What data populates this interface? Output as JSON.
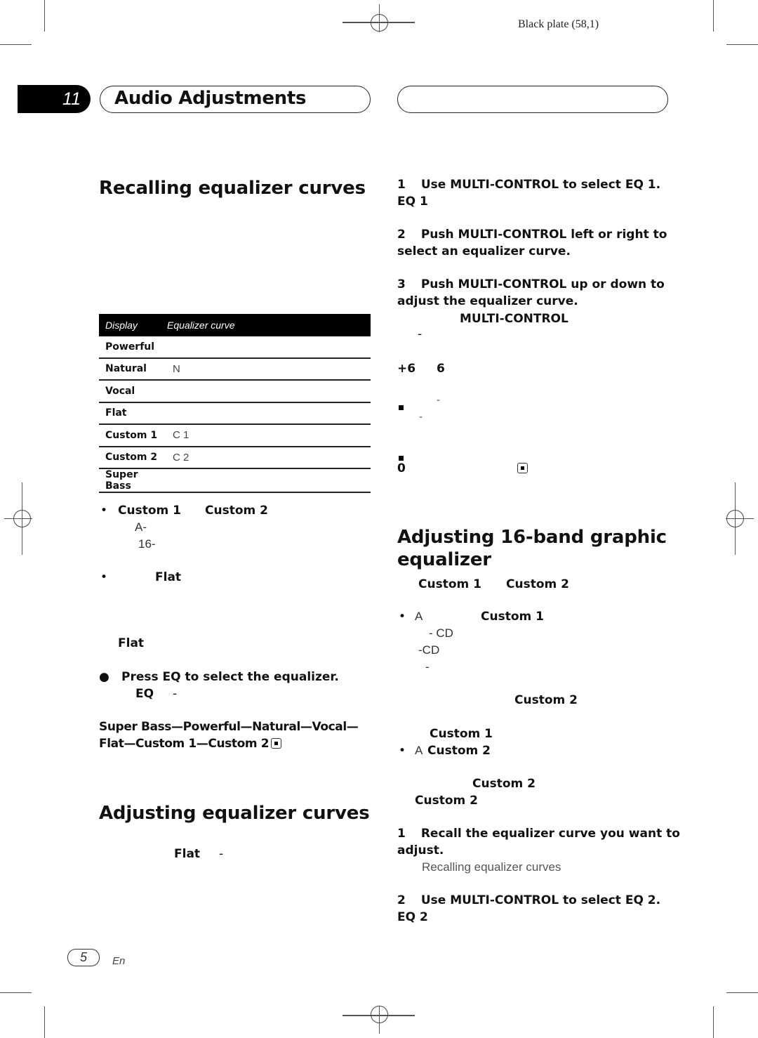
{
  "plate_label": "Black plate (58,1)",
  "header": {
    "chapter_number": "11",
    "chapter_title": "Audio Adjustments"
  },
  "left": {
    "recall_heading": "Recalling equalizer curves",
    "table": {
      "headers": [
        "Display",
        "Equalizer curve"
      ],
      "rows": [
        {
          "display": "Powerful",
          "curve": ""
        },
        {
          "display": "Natural",
          "curve": "N"
        },
        {
          "display": "Vocal",
          "curve": ""
        },
        {
          "display": "Flat",
          "curve": ""
        },
        {
          "display": "Custom 1",
          "curve": "C 1"
        },
        {
          "display": "Custom 2",
          "curve": "C 2"
        },
        {
          "display": "Super Bass",
          "curve": ""
        }
      ]
    },
    "notes": {
      "bullet1_a": "Custom 1",
      "bullet1_b": "Custom 2",
      "bullet1_line2": "A-",
      "bullet1_line3": "16-",
      "bullet2": "Flat",
      "flat_line": "Flat"
    },
    "step": {
      "bullet": "●",
      "title": "Press EQ to select the equalizer.",
      "eq_label": "EQ",
      "dash": "-",
      "cycle_line1": "Super Bass—Powerful—Natural—Vocal—",
      "cycle_line2": "Flat—Custom 1—Custom 2"
    },
    "adjust_heading": "Adjusting equalizer curves",
    "adjust_flat": "Flat",
    "adjust_dash": "-"
  },
  "right": {
    "step1": {
      "num": "1",
      "text": "Use MULTI-CONTROL to select EQ 1.",
      "sub": "EQ 1"
    },
    "step2": {
      "num": "2",
      "line1": "Push MULTI-CONTROL left or right to",
      "line2": "select an equalizer curve."
    },
    "step3": {
      "num": "3",
      "line1": "Push MULTI-CONTROL up or down to",
      "line2": "adjust the equalizer curve.",
      "sub": "MULTI-CONTROL",
      "dash": "-"
    },
    "range": {
      "max": "+6",
      "min": "6"
    },
    "notes": {
      "dash1": "-",
      "dash2": "-",
      "zero": "0"
    },
    "graphic_heading_line1": "Adjusting 16-band graphic",
    "graphic_heading_line2": "equalizer",
    "graphic": {
      "intro_a": "Custom 1",
      "intro_b": "Custom 2",
      "bullet1_a": "A",
      "bullet1_b": "Custom 1",
      "cd1": "- CD",
      "cd2": "-CD",
      "dash": "-",
      "custom2_a": "Custom 2",
      "custom1": "Custom 1",
      "bullet2_a": "A",
      "bullet2_b": "Custom 2",
      "custom2_b": "Custom 2",
      "custom2_c": "Custom 2"
    },
    "stepA": {
      "num": "1",
      "line1": "Recall the equalizer curve you want to",
      "line2": "adjust.",
      "ref": "Recalling equalizer curves"
    },
    "stepB": {
      "num": "2",
      "text": "Use MULTI-CONTROL to select EQ 2.",
      "sub": "EQ 2"
    }
  },
  "footer": {
    "page_number": "5",
    "language": "En"
  }
}
